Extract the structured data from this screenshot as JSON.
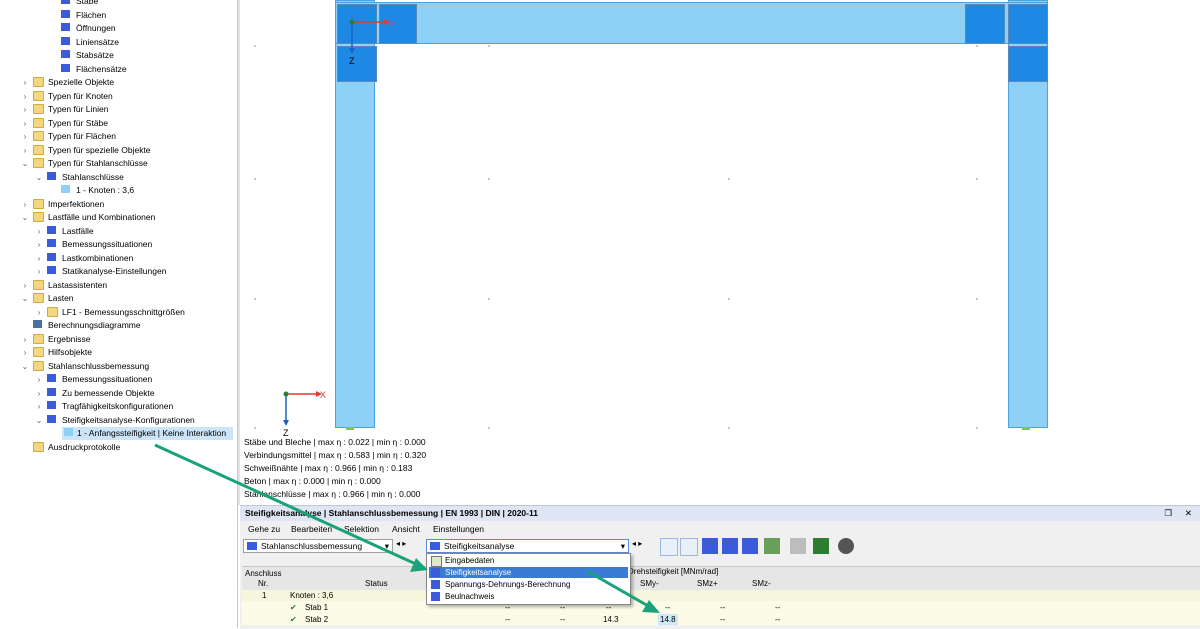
{
  "tree": {
    "items": [
      {
        "label": "Stäbe",
        "indent": 3,
        "icon": "member-icon",
        "exp": ""
      },
      {
        "label": "Flächen",
        "indent": 3,
        "icon": "surface-icon",
        "exp": ""
      },
      {
        "label": "Öffnungen",
        "indent": 3,
        "icon": "opening-icon",
        "exp": ""
      },
      {
        "label": "Liniensätze",
        "indent": 3,
        "icon": "lineset-icon",
        "exp": ""
      },
      {
        "label": "Stabsätze",
        "indent": 3,
        "icon": "memberset-icon",
        "exp": ""
      },
      {
        "label": "Flächensätze",
        "indent": 3,
        "icon": "surfaceset-icon",
        "exp": ""
      },
      {
        "label": "Spezielle Objekte",
        "indent": 1,
        "icon": "folder-icon",
        "exp": ">"
      },
      {
        "label": "Typen für Knoten",
        "indent": 1,
        "icon": "folder-icon",
        "exp": ">"
      },
      {
        "label": "Typen für Linien",
        "indent": 1,
        "icon": "folder-icon",
        "exp": ">"
      },
      {
        "label": "Typen für Stäbe",
        "indent": 1,
        "icon": "folder-icon",
        "exp": ">"
      },
      {
        "label": "Typen für Flächen",
        "indent": 1,
        "icon": "folder-icon",
        "exp": ">"
      },
      {
        "label": "Typen für spezielle Objekte",
        "indent": 1,
        "icon": "folder-icon",
        "exp": ">"
      },
      {
        "label": "Typen für Stahlanschlüsse",
        "indent": 1,
        "icon": "folder-icon",
        "exp": "v"
      },
      {
        "label": "Stahlanschlüsse",
        "indent": 2,
        "icon": "steel-joint-icon",
        "exp": "v"
      },
      {
        "label": "1 - Knoten : 3,6",
        "indent": 3,
        "icon": "swatch-icon",
        "exp": ""
      },
      {
        "label": "Imperfektionen",
        "indent": 1,
        "icon": "folder-icon",
        "exp": ">"
      },
      {
        "label": "Lastfälle und Kombinationen",
        "indent": 1,
        "icon": "folder-icon",
        "exp": "v"
      },
      {
        "label": "Lastfälle",
        "indent": 2,
        "icon": "loadcase-icon",
        "exp": ">"
      },
      {
        "label": "Bemessungssituationen",
        "indent": 2,
        "icon": "design-situation-icon",
        "exp": ">"
      },
      {
        "label": "Lastkombinationen",
        "indent": 2,
        "icon": "load-combination-icon",
        "exp": ">"
      },
      {
        "label": "Statikanalyse-Einstellungen",
        "indent": 2,
        "icon": "analysis-settings-icon",
        "exp": ">"
      },
      {
        "label": "Lastassistenten",
        "indent": 1,
        "icon": "folder-icon",
        "exp": ">"
      },
      {
        "label": "Lasten",
        "indent": 1,
        "icon": "folder-icon",
        "exp": "v"
      },
      {
        "label": "LF1 - Bemessungsschnittgrößen",
        "indent": 2,
        "icon": "folder-icon",
        "exp": ">"
      },
      {
        "label": "Berechnungsdiagramme",
        "indent": 1,
        "icon": "diagram-icon",
        "exp": ""
      },
      {
        "label": "Ergebnisse",
        "indent": 1,
        "icon": "folder-icon",
        "exp": ">"
      },
      {
        "label": "Hilfsobjekte",
        "indent": 1,
        "icon": "folder-icon",
        "exp": ">"
      },
      {
        "label": "Stahlanschlussbemessung",
        "indent": 1,
        "icon": "folder-icon",
        "exp": "v"
      },
      {
        "label": "Bemessungssituationen",
        "indent": 2,
        "icon": "design-situation-icon",
        "exp": ">"
      },
      {
        "label": "Zu bemessende Objekte",
        "indent": 2,
        "icon": "objects-icon",
        "exp": ">"
      },
      {
        "label": "Tragfähigkeitskonfigurationen",
        "indent": 2,
        "icon": "config-icon",
        "exp": ">"
      },
      {
        "label": "Steifigkeitsanalyse-Konfigurationen",
        "indent": 2,
        "icon": "config-icon",
        "exp": "v"
      },
      {
        "label": "1 - Anfangssteifigkeit | Keine Interaktion",
        "indent": 3,
        "icon": "swatch-icon",
        "exp": "",
        "selected": true
      },
      {
        "label": "Ausdruckprotokolle",
        "indent": 1,
        "icon": "folder-icon",
        "exp": ""
      }
    ]
  },
  "viewport": {
    "axis_top": {
      "x": "x",
      "z": "Z"
    },
    "axis_bottom": {
      "x": "X",
      "z": "Z"
    },
    "stats": [
      "Stäbe und Bleche | max η : 0.022 | min η : 0.000",
      "Verbindungsmittel | max η : 0.583 | min η : 0.320",
      "Schweißnähte | max η : 0.966 | min η : 0.183",
      "Beton | max η : 0.000 | min η : 0.000",
      "Stahlanschlüsse | max η : 0.966 | min η : 0.000"
    ]
  },
  "panel": {
    "title": "Steifigkeitsanalyse | Stahlanschlussbemessung | EN 1993 | DIN | 2020-11",
    "menu": [
      "Gehe zu",
      "Bearbeiten",
      "Selektion",
      "Ansicht",
      "Einstellungen"
    ],
    "module_select": "Stahlanschlussbemessung",
    "result_select": "Steifigkeitsanalyse",
    "dropdown_options": [
      "Eingabedaten",
      "Steifigkeitsanalyse",
      "Spannungs-Dehnungs-Berechnung",
      "Beulnachweis"
    ],
    "selected_option_index": 1,
    "table": {
      "header_anschluss": "Anschluss",
      "header_nr": "Nr.",
      "header_status": "Status",
      "header_group": "Drehsteifigkeit [MNm/rad]",
      "header_smy_minus": "SMy-",
      "header_smz_plus": "SMz+",
      "header_smz_minus": "SMz-",
      "rows": [
        {
          "nr": "1",
          "label": "Knoten : 3,6",
          "group": true
        },
        {
          "label": "Stab 1",
          "status": "ok",
          "c1": "--",
          "c2": "--",
          "c3": "--",
          "c4": "--",
          "c5": "--",
          "c6": "--"
        },
        {
          "label": "Stab 2",
          "status": "ok",
          "c1": "--",
          "c2": "--",
          "c3": "14.3",
          "c4": "14.8",
          "c5": "--",
          "c6": "--"
        }
      ]
    }
  },
  "colors": {
    "arrow": "#1aa37a",
    "selection": "#3a7bd5",
    "member": "#8fd0f7",
    "plate": "#1e88e5"
  }
}
